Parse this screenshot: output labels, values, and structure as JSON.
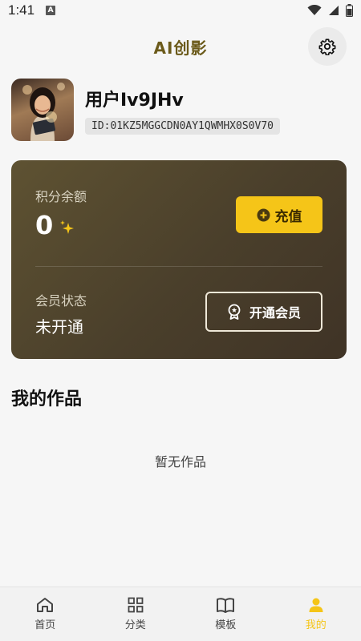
{
  "status_bar": {
    "time": "1:41",
    "notice_icon": "A"
  },
  "header": {
    "title": "AI创影",
    "settings_icon": "gear-icon"
  },
  "profile": {
    "username": "用户Iv9JHv",
    "user_id": "ID:01KZ5MGGCDN0AY1QWMHX0S0V70"
  },
  "wallet": {
    "points_label": "积分余额",
    "points_value": "0",
    "recharge_label": "充值",
    "member_label": "会员状态",
    "member_value": "未开通",
    "vip_button_label": "开通会员",
    "accent_color": "#f5c518"
  },
  "works": {
    "title": "我的作品",
    "empty_text": "暂无作品"
  },
  "nav": {
    "items": [
      {
        "label": "首页",
        "icon": "home-icon"
      },
      {
        "label": "分类",
        "icon": "grid-icon"
      },
      {
        "label": "模板",
        "icon": "book-icon"
      },
      {
        "label": "我的",
        "icon": "user-icon",
        "active": true
      }
    ]
  }
}
